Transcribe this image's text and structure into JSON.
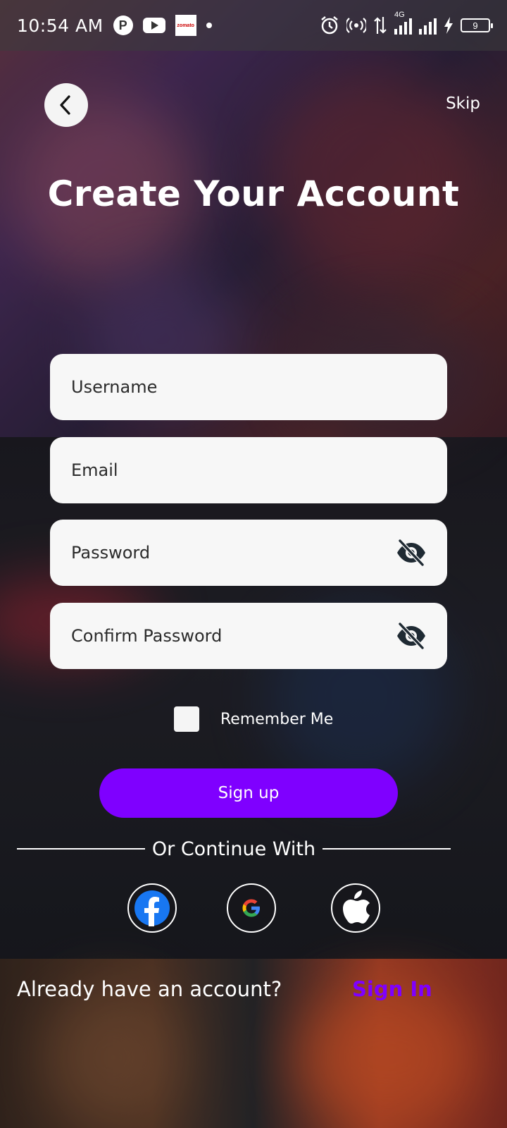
{
  "status_bar": {
    "time": "10:54 AM",
    "app_icons": [
      "p-icon",
      "youtube-icon",
      "zomato-icon"
    ],
    "zomato_label": "zomato",
    "network_label": "4G",
    "battery_level": "9"
  },
  "header": {
    "back_icon": "chevron-left-icon",
    "skip_label": "Skip",
    "title": "Create Your Account"
  },
  "form": {
    "username_placeholder": "Username",
    "email_placeholder": "Email",
    "password_placeholder": "Password",
    "confirm_password_placeholder": "Confirm Password",
    "password_visibility_icon": "eye-off-icon",
    "remember_me_label": "Remember Me",
    "remember_me_checked": false,
    "signup_label": "Sign up"
  },
  "social": {
    "divider_text": "Or Continue With",
    "providers": [
      "facebook-icon",
      "google-icon",
      "apple-icon"
    ]
  },
  "footer": {
    "prompt": "Already have an account?",
    "signin_label": "Sign In"
  },
  "colors": {
    "accent": "#7f00ff",
    "field_bg": "#f7f7f7",
    "text_dark": "#2b2b2b",
    "facebook_blue": "#1877f2"
  }
}
